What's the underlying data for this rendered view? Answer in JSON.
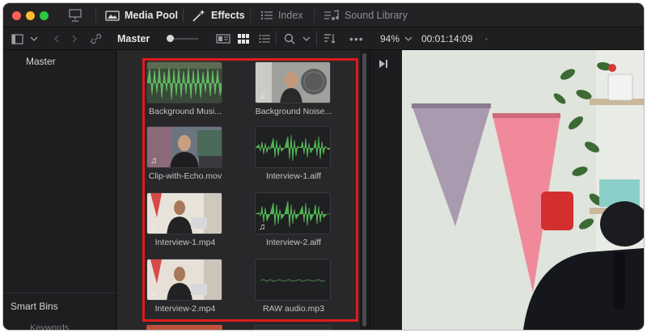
{
  "topbar": {
    "items": [
      {
        "label": "Media Pool",
        "icon": "media-pool-icon",
        "active": true
      },
      {
        "label": "Effects",
        "icon": "effects-wand-icon",
        "active": true
      },
      {
        "label": "Index",
        "icon": "index-list-icon",
        "active": false
      },
      {
        "label": "Sound Library",
        "icon": "sound-library-icon",
        "active": false
      }
    ]
  },
  "toolbar": {
    "bin_name": "Master",
    "zoom": "94%",
    "timecode": "00:01:14:09"
  },
  "bins": {
    "master_label": "Master",
    "smart_bins_label": "Smart Bins",
    "keywords_label": "Keywords"
  },
  "clips": [
    {
      "name": "Background Musi...",
      "kind": "audio-waveform"
    },
    {
      "name": "Background Noise...",
      "kind": "video-with-audio"
    },
    {
      "name": "Clip-with-Echo.mov",
      "kind": "video-with-audio"
    },
    {
      "name": "Interview-1.aiff",
      "kind": "audio-waveform"
    },
    {
      "name": "Interview-1.mp4",
      "kind": "video-with-audio"
    },
    {
      "name": "Interview-2.aiff",
      "kind": "audio-waveform"
    },
    {
      "name": "Interview-2.mp4",
      "kind": "video-with-audio"
    },
    {
      "name": "RAW audio.mp3",
      "kind": "audio-flat"
    }
  ],
  "colors": {
    "accent_red": "#e01b1b",
    "waveform_green": "#4caf50",
    "panel_bg": "#28282b"
  }
}
